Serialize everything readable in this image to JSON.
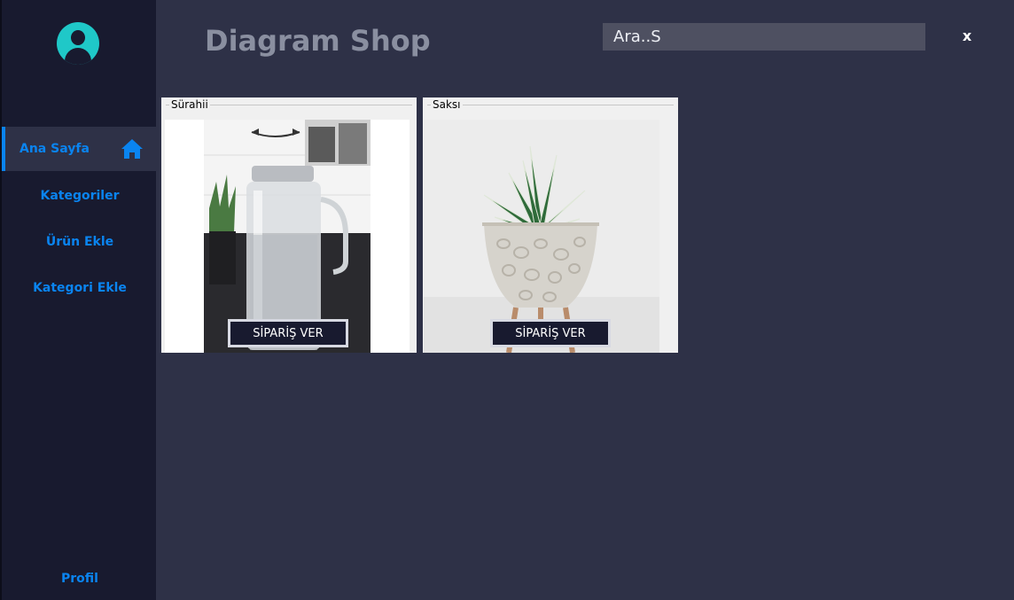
{
  "app": {
    "title": "Diagram Shop"
  },
  "sidebar": {
    "items": [
      {
        "label": "Ana Sayfa",
        "icon": "home-icon",
        "active": true
      },
      {
        "label": "Kategoriler"
      },
      {
        "label": "Ürün Ekle"
      },
      {
        "label": "Kategori Ekle"
      }
    ],
    "profile_label": "Profil"
  },
  "search": {
    "value": "Ara..S"
  },
  "close_label": "x",
  "products": [
    {
      "name": "Sürahii",
      "button_label": "SİPARİŞ VER"
    },
    {
      "name": "Saksı",
      "button_label": "SİPARİŞ VER"
    }
  ],
  "colors": {
    "accent": "#0a84f0",
    "sidebar_bg": "#181a2f",
    "main_bg": "#2e3147",
    "avatar": "#1fc8c8"
  }
}
